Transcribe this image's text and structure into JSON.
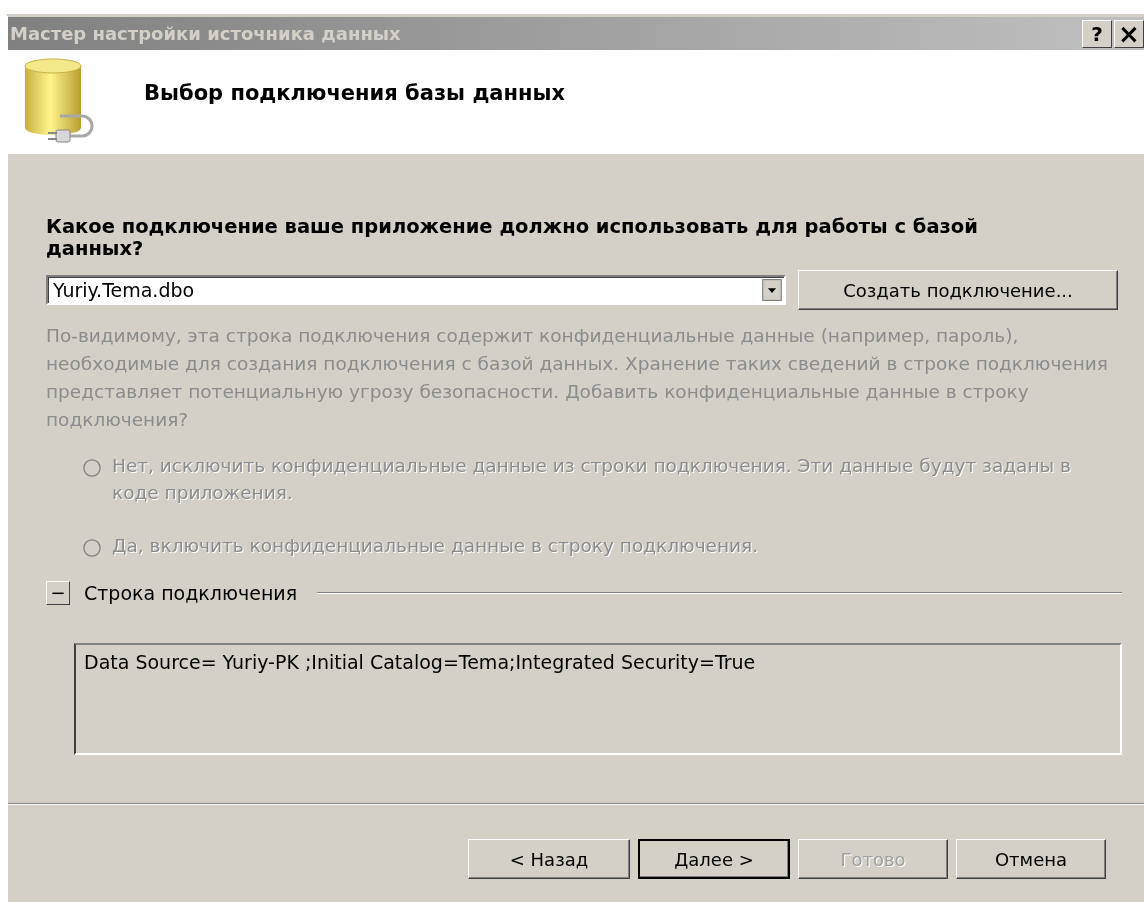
{
  "window": {
    "title": "Мастер настройки источника данных",
    "active": false,
    "buttons": [
      {
        "kind": "help",
        "label": "?"
      },
      {
        "kind": "close",
        "label": "×"
      }
    ]
  },
  "header": {
    "title": "Выбор подключения базы данных"
  },
  "question": "Какое подключение ваше приложение должно использовать для работы с базой данных?",
  "connection": {
    "value": "Yuriy.Tema.dbo"
  },
  "new_connection_button": "Создать подключение...",
  "warning": {
    "text": "По-видимому, эта строка подключения содержит конфиденциальные данные (например, пароль), необходимые для создания подключения с базой данных. Хранение таких сведений в строке подключения представляет потенциальную угрозу безопасности. Добавить конфиденциальные данные в строку подключения?",
    "disabled": true
  },
  "options": [
    {
      "label": "Нет, исключить конфиденциальные данные из строки подключения. Эти данные будут заданы в коде приложения.",
      "selected": false,
      "disabled": true
    },
    {
      "label": "Да, включить конфиденциальные данные в строку подключения.",
      "selected": false,
      "disabled": true
    }
  ],
  "connection_string": {
    "toggle": "−",
    "label": "Строка подключения",
    "expanded": true,
    "value": "Data Source= Yuriy-PK ;Initial Catalog=Tema;Integrated Security=True"
  },
  "buttons": [
    {
      "label": "< Назад",
      "default": false,
      "disabled": false
    },
    {
      "label": "Далее >",
      "default": true,
      "disabled": false
    },
    {
      "label": "Готово",
      "default": false,
      "disabled": true
    },
    {
      "label": "Отмена",
      "default": false,
      "disabled": false
    }
  ]
}
